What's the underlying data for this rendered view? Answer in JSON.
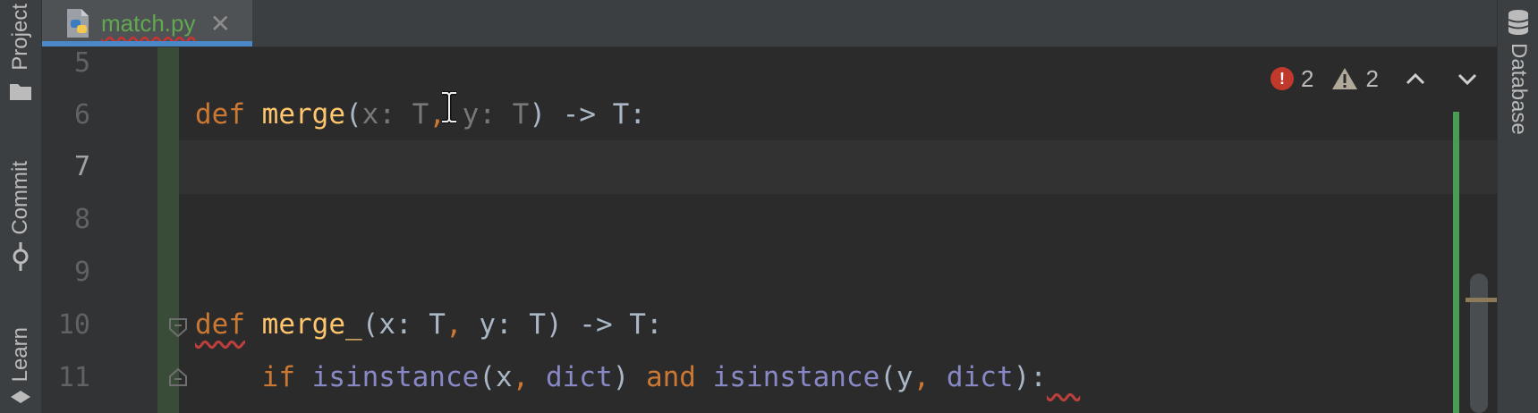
{
  "tab": {
    "filename": "match.py",
    "close_glyph": "✕",
    "icon": "python-file-icon"
  },
  "left_tools": [
    {
      "label": "Project",
      "icon": "folder-icon"
    },
    {
      "label": "Commit",
      "icon": "commit-icon"
    },
    {
      "label": "Learn",
      "icon": "learn-icon"
    }
  ],
  "right_tools": [
    {
      "label": "Database",
      "icon": "database-icon"
    }
  ],
  "inspections": {
    "errors": "2",
    "warnings": "2"
  },
  "line_numbers": [
    "5",
    "6",
    "7",
    "8",
    "9",
    "10",
    "11"
  ],
  "current_line": "7",
  "code": {
    "line6": {
      "def": "def",
      "name": "merge",
      "open": "(",
      "x": "x: ",
      "t1": "T",
      "comma": ",",
      "y": " y: ",
      "t2": "T",
      "close": ") -> T:"
    },
    "line10": {
      "def": "def",
      "name": "merge_",
      "sig": "(x: T",
      "comma": ",",
      "rest": " y: T) -> T:"
    },
    "line11": {
      "if": "if",
      "isinstance1": "isinstance",
      "args1a": "(x",
      "comma1": ",",
      "dict1": " dict",
      "close1": ")",
      "and": " and ",
      "isinstance2": "isinstance",
      "args2a": "(y",
      "comma2": ",",
      "dict2": " dict",
      "close2": "):"
    }
  },
  "colors": {
    "keyword": "#cc7832",
    "function": "#ffc66d",
    "builtin": "#8888c6",
    "text": "#a9b7c6",
    "error": "#c0392b",
    "tab_underline": "#4a88c7",
    "changed_gutter": "#384c38"
  }
}
